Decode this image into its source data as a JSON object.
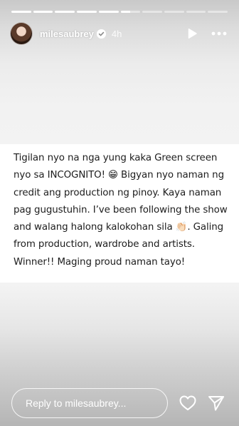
{
  "progress": {
    "segments": [
      1,
      1,
      1,
      1,
      1,
      0.5,
      0,
      0,
      0,
      0
    ]
  },
  "header": {
    "username": "milesaubrey",
    "time_ago": "4h",
    "icons": {
      "verified": "verified-badge-icon",
      "play": "play-icon",
      "more": "more-options-icon"
    }
  },
  "post": {
    "text": "Tigilan nyo na nga yung kaka Green screen nyo sa INCOGNITO! 😁 Bigyan nyo naman ng credit ang production ng pinoy. Kaya naman pag gugustuhin. I’ve been following the show and walang halong kalokohan sila 👏🏻. Galing from production, wardrobe and artists. Winner!! Maging proud naman tayo!"
  },
  "footer": {
    "reply_placeholder": "Reply to milesaubrey...",
    "icons": {
      "like": "heart-icon",
      "send": "send-icon"
    }
  }
}
